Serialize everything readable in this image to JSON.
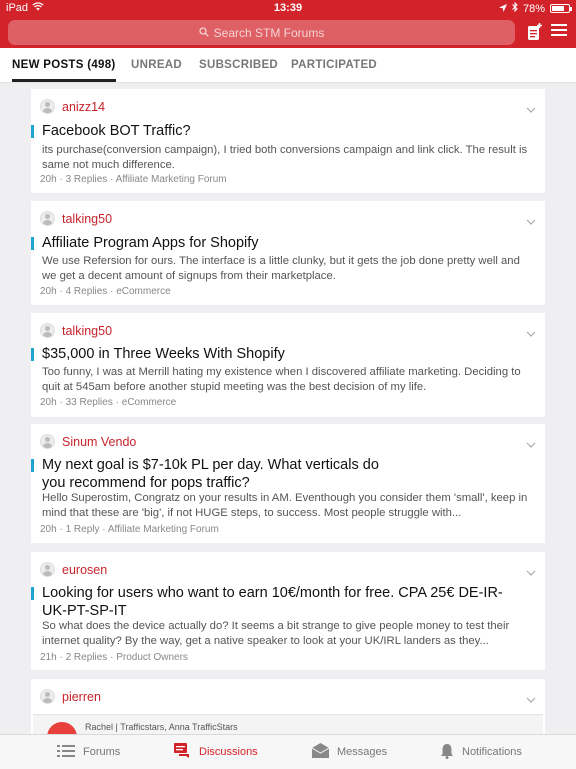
{
  "status": {
    "device": "iPad",
    "time": "13:39",
    "battery": "78%",
    "battery_level": 0.78
  },
  "header": {
    "search_placeholder": "Search STM Forums",
    "icons": [
      "search-icon",
      "compose-icon",
      "menu-icon"
    ],
    "brand_color": "#d2232a"
  },
  "tabs": [
    {
      "label": "NEW POSTS (498)",
      "active": true
    },
    {
      "label": "UNREAD",
      "active": false
    },
    {
      "label": "SUBSCRIBED",
      "active": false
    },
    {
      "label": "PARTICIPATED",
      "active": false
    }
  ],
  "posts": [
    {
      "author": "anizz14",
      "title": "Facebook BOT Traffic?",
      "excerpt": "its purchase(conversion campaign), I tried both conversions campaign and link click. The result is same not much difference.",
      "age": "20h",
      "replies": "3 Replies",
      "forum": "Affiliate Marketing Forum"
    },
    {
      "author": "talking50",
      "title": "Affiliate Program Apps for Shopify",
      "excerpt": "We use Refersion for ours. The interface is a little clunky, but it gets the job done pretty well and we get a decent amount of signups from their marketplace.",
      "age": "20h",
      "replies": "4 Replies",
      "forum": "eCommerce"
    },
    {
      "author": "talking50",
      "title": "$35,000 in Three Weeks With Shopify",
      "excerpt": "Too funny, I was at Merrill hating my existence when I discovered affiliate marketing. Deciding to quit at 545am before another stupid meeting was the best decision of my life.",
      "age": "20h",
      "replies": "33 Replies",
      "forum": "eCommerce"
    },
    {
      "author": "Sinum Vendo",
      "title": "My next goal is $7-10k PL per day. What verticals do you recommend for pops traffic?",
      "excerpt": "Hello Superostim, Congratz on your results in AM. Eventhough you consider them 'small', keep in mind that these are 'big', if not HUGE steps, to success. Most people struggle with...",
      "age": "20h",
      "replies": "1 Reply",
      "forum": "Affiliate Marketing Forum"
    },
    {
      "author": "eurosen",
      "title": "Looking for users who want to earn 10€/month for free. CPA 25€ DE-IR-UK-PT-SP-IT",
      "excerpt": "So what does the device actually do? It seems a bit strange to give people money to test their internet quality? By the way, get a native speaker to look at your UK/IRL landers as they...",
      "age": "21h",
      "replies": "2 Replies",
      "forum": "Product Owners"
    },
    {
      "author": "pierren",
      "title": "",
      "excerpt": "",
      "age": "",
      "replies": "",
      "forum": "",
      "embed_text": "Rachel | Trafficstars, Anna TrafficStars"
    }
  ],
  "separator": "·",
  "bottom_nav": [
    {
      "label": "Forums",
      "icon": "forums-list-icon",
      "active": false
    },
    {
      "label": "Discussions",
      "icon": "discussions-icon",
      "active": true
    },
    {
      "label": "Messages",
      "icon": "messages-icon",
      "active": false
    },
    {
      "label": "Notifications",
      "icon": "bell-icon",
      "active": false
    }
  ],
  "colors": {
    "accent_red": "#d2232a",
    "title_marker": "#1fa3d1",
    "author": "#c8232b"
  }
}
